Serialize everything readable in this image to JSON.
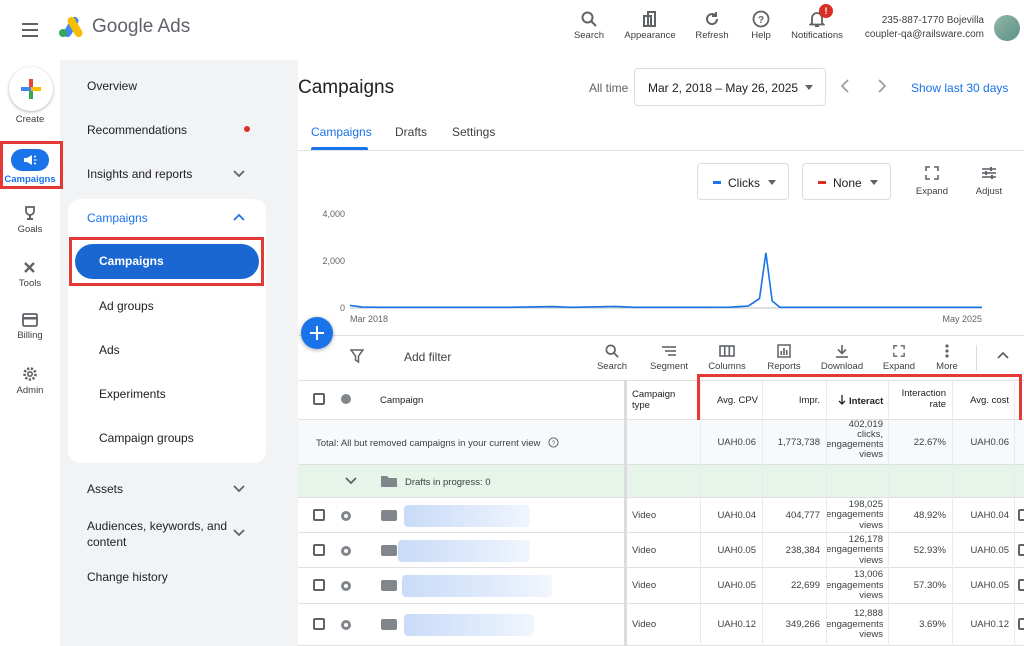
{
  "app": {
    "name": "Google Ads"
  },
  "topbar": {
    "tools": [
      {
        "icon": "search-icon",
        "label": "Search"
      },
      {
        "icon": "appearance-icon",
        "label": "Appearance"
      },
      {
        "icon": "refresh-icon",
        "label": "Refresh"
      },
      {
        "icon": "help-icon",
        "label": "Help"
      },
      {
        "icon": "bell-icon",
        "label": "Notifications",
        "badge": "!"
      }
    ],
    "account_id": "235-887-1770 Bojevilla",
    "account_email": "coupler-qa@railsware.com"
  },
  "rail": {
    "create": "Create",
    "items": [
      {
        "icon": "megaphone-icon",
        "label": "Campaigns"
      },
      {
        "icon": "trophy-icon",
        "label": "Goals"
      },
      {
        "icon": "tools-icon",
        "label": "Tools"
      },
      {
        "icon": "billing-icon",
        "label": "Billing"
      },
      {
        "icon": "gear-icon",
        "label": "Admin"
      }
    ]
  },
  "nav": {
    "overview": "Overview",
    "recommendations": "Recommendations",
    "insights": "Insights and reports",
    "campaigns_group": "Campaigns",
    "sub": [
      "Campaigns",
      "Ad groups",
      "Ads",
      "Experiments",
      "Campaign groups"
    ],
    "assets": "Assets",
    "audiences": "Audiences, keywords, and content",
    "change_history": "Change history"
  },
  "main": {
    "title": "Campaigns",
    "all_time": "All time",
    "date_range": "Mar 2, 2018 – May 26, 2025",
    "show_last": "Show last 30 days",
    "tabs": [
      "Campaigns",
      "Drafts",
      "Settings"
    ],
    "metric1": "Clicks",
    "metric2": "None",
    "expand": "Expand",
    "adjust": "Adjust",
    "colors": {
      "accent": "#1a73e8",
      "metric1": "#1a73e8",
      "metric2": "#d93025",
      "highlight": "#e53935"
    }
  },
  "chart_data": {
    "type": "line",
    "x_start": "Mar 2018",
    "x_end": "May 2025",
    "x_tick_labels": [
      "Mar 2018",
      "May 2025"
    ],
    "y_ticks": [
      "4,000",
      "2,000",
      "0"
    ],
    "ylim": [
      0,
      4000
    ],
    "series": [
      {
        "name": "Clicks",
        "points": [
          [
            0,
            110
          ],
          [
            0.02,
            40
          ],
          [
            0.05,
            30
          ],
          [
            0.15,
            30
          ],
          [
            0.25,
            30
          ],
          [
            0.32,
            60
          ],
          [
            0.35,
            30
          ],
          [
            0.42,
            70
          ],
          [
            0.45,
            30
          ],
          [
            0.55,
            30
          ],
          [
            0.6,
            35
          ],
          [
            0.63,
            80
          ],
          [
            0.648,
            400
          ],
          [
            0.658,
            2350
          ],
          [
            0.668,
            300
          ],
          [
            0.68,
            30
          ],
          [
            0.8,
            30
          ],
          [
            0.9,
            30
          ],
          [
            1.0,
            30
          ]
        ]
      }
    ]
  },
  "toolbar": {
    "add_filter": "Add filter",
    "tools": [
      {
        "icon": "search-icon",
        "label": "Search"
      },
      {
        "icon": "segment-icon",
        "label": "Segment"
      },
      {
        "icon": "columns-icon",
        "label": "Columns"
      },
      {
        "icon": "reports-icon",
        "label": "Reports"
      },
      {
        "icon": "download-icon",
        "label": "Download"
      },
      {
        "icon": "expand-icon",
        "label": "Expand"
      },
      {
        "icon": "more-icon",
        "label": "More"
      }
    ]
  },
  "table": {
    "headers": {
      "campaign": "Campaign",
      "campaign_type": "Campaign type",
      "avg_cpv": "Avg. CPV",
      "impr": "Impr.",
      "interactions": "Interactions",
      "interaction_rate": "Interaction rate",
      "avg_cost": "Avg. cost"
    },
    "total": {
      "label": "Total: All but removed campaigns in your current view",
      "avg_cpv": "UAH0.06",
      "impr": "1,773,738",
      "interactions": [
        "402,019",
        "clicks,",
        "engagements,",
        "views"
      ],
      "interaction_rate": "22.67%",
      "avg_cost": "UAH0.06"
    },
    "drafts": "Drafts in progress: 0",
    "rows": [
      {
        "type": "Video",
        "avg_cpv": "UAH0.04",
        "impr": "404,777",
        "interactions": [
          "198,025",
          "engagements,",
          "views"
        ],
        "interaction_rate": "48.92%",
        "avg_cost": "UAH0.04"
      },
      {
        "type": "Video",
        "avg_cpv": "UAH0.05",
        "impr": "238,384",
        "interactions": [
          "126,178",
          "engagements,",
          "views"
        ],
        "interaction_rate": "52.93%",
        "avg_cost": "UAH0.05"
      },
      {
        "type": "Video",
        "avg_cpv": "UAH0.05",
        "impr": "22,699",
        "interactions": [
          "13,006",
          "engagements,",
          "views"
        ],
        "interaction_rate": "57.30%",
        "avg_cost": "UAH0.05"
      },
      {
        "type": "Video",
        "avg_cpv": "UAH0.12",
        "impr": "349,266",
        "interactions": [
          "12,888",
          "engagements,",
          "views"
        ],
        "interaction_rate": "3.69%",
        "avg_cost": "UAH0.12"
      }
    ]
  }
}
